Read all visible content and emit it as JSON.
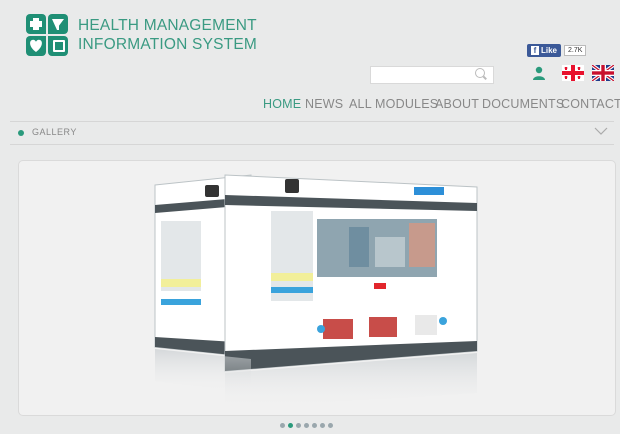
{
  "brand": {
    "line1": "HEALTH MANAGEMENT",
    "line2": "INFORMATION SYSTEM",
    "color": "#3a9a82"
  },
  "facebook": {
    "like_label": "Like",
    "count": "2.7K"
  },
  "search": {
    "placeholder": ""
  },
  "nav": {
    "items": [
      {
        "label": "HOME",
        "active": true
      },
      {
        "label": "NEWS"
      },
      {
        "label": "ALL MODULES"
      },
      {
        "label": "ABOUT"
      },
      {
        "label": "DOCUMENTS"
      },
      {
        "label": "CONTACT"
      }
    ]
  },
  "section": {
    "label": "GALLERY"
  },
  "carousel": {
    "slide_count": 7,
    "active_index": 1
  },
  "colors": {
    "accent": "#2a9a7c",
    "background": "#e9eaea"
  }
}
